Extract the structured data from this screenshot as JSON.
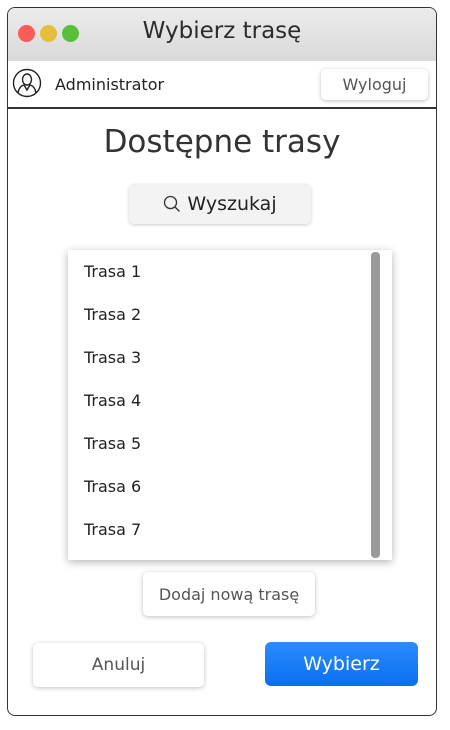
{
  "window": {
    "title": "Wybierz trasę"
  },
  "userbar": {
    "username": "Administrator",
    "logout_label": "Wyloguj"
  },
  "main": {
    "heading": "Dostępne trasy",
    "search_label": "Wyszukaj",
    "routes": [
      "Trasa 1",
      "Trasa 2",
      "Trasa 3",
      "Trasa 4",
      "Trasa 5",
      "Trasa 6",
      "Trasa 7"
    ],
    "add_label": "Dodaj nową trasę"
  },
  "footer": {
    "cancel_label": "Anuluj",
    "choose_label": "Wybierz"
  },
  "colors": {
    "accent": "#1a7cf5",
    "close": "#fc5b57",
    "minimize": "#e5bf3c",
    "maximize": "#57c038"
  },
  "icons": {
    "user": "user-icon",
    "search": "search-icon"
  }
}
